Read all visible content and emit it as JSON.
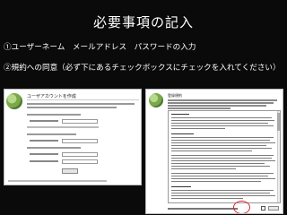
{
  "slide": {
    "title": "必要事項の記入",
    "step1": "①ユーザーネーム　メールアドレス　パスワードの入力",
    "step2": "②規約への同意（必ず下にあるチェックボックスにチェックを入れてください）"
  },
  "left_screenshot": {
    "page_title": "ユーザアカウントを作成",
    "fields": [
      "username",
      "email",
      "password",
      "password-confirm"
    ]
  },
  "right_screenshot": {
    "page_title": "登録規約"
  },
  "colors": {
    "background": "#0a0a0a",
    "highlight_circle": "#e02020"
  }
}
